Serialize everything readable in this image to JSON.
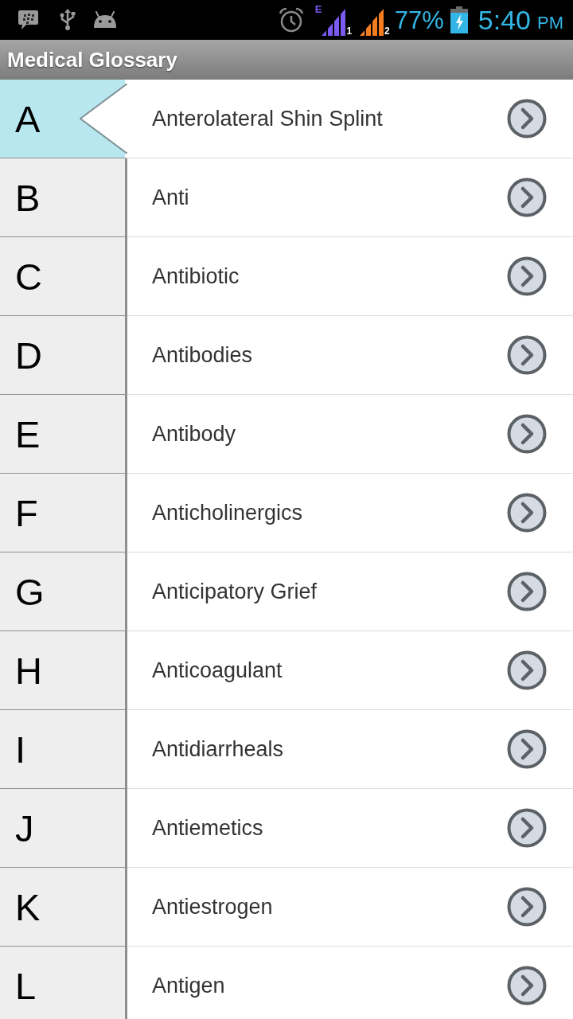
{
  "status_bar": {
    "network_type": "E",
    "sims": [
      {
        "label": "1",
        "color": "#7b5af2"
      },
      {
        "label": "2",
        "color": "#f57c1f"
      }
    ],
    "battery": "77%",
    "time": "5:40",
    "meridiem": "PM"
  },
  "app_bar": {
    "title": "Medical Glossary"
  },
  "index": [
    {
      "letter": "A",
      "selected": true
    },
    {
      "letter": "B",
      "selected": false
    },
    {
      "letter": "C",
      "selected": false
    },
    {
      "letter": "D",
      "selected": false
    },
    {
      "letter": "E",
      "selected": false
    },
    {
      "letter": "F",
      "selected": false
    },
    {
      "letter": "G",
      "selected": false
    },
    {
      "letter": "H",
      "selected": false
    },
    {
      "letter": "I",
      "selected": false
    },
    {
      "letter": "J",
      "selected": false
    },
    {
      "letter": "K",
      "selected": false
    },
    {
      "letter": "L",
      "selected": false
    }
  ],
  "terms": [
    {
      "label": "Anterolateral Shin Splint"
    },
    {
      "label": "Anti"
    },
    {
      "label": "Antibiotic"
    },
    {
      "label": "Antibodies"
    },
    {
      "label": "Antibody"
    },
    {
      "label": "Anticholinergics"
    },
    {
      "label": "Anticipatory Grief"
    },
    {
      "label": "Anticoagulant"
    },
    {
      "label": "Antidiarrheals"
    },
    {
      "label": "Antiemetics"
    },
    {
      "label": "Antiestrogen"
    },
    {
      "label": "Antigen"
    }
  ]
}
